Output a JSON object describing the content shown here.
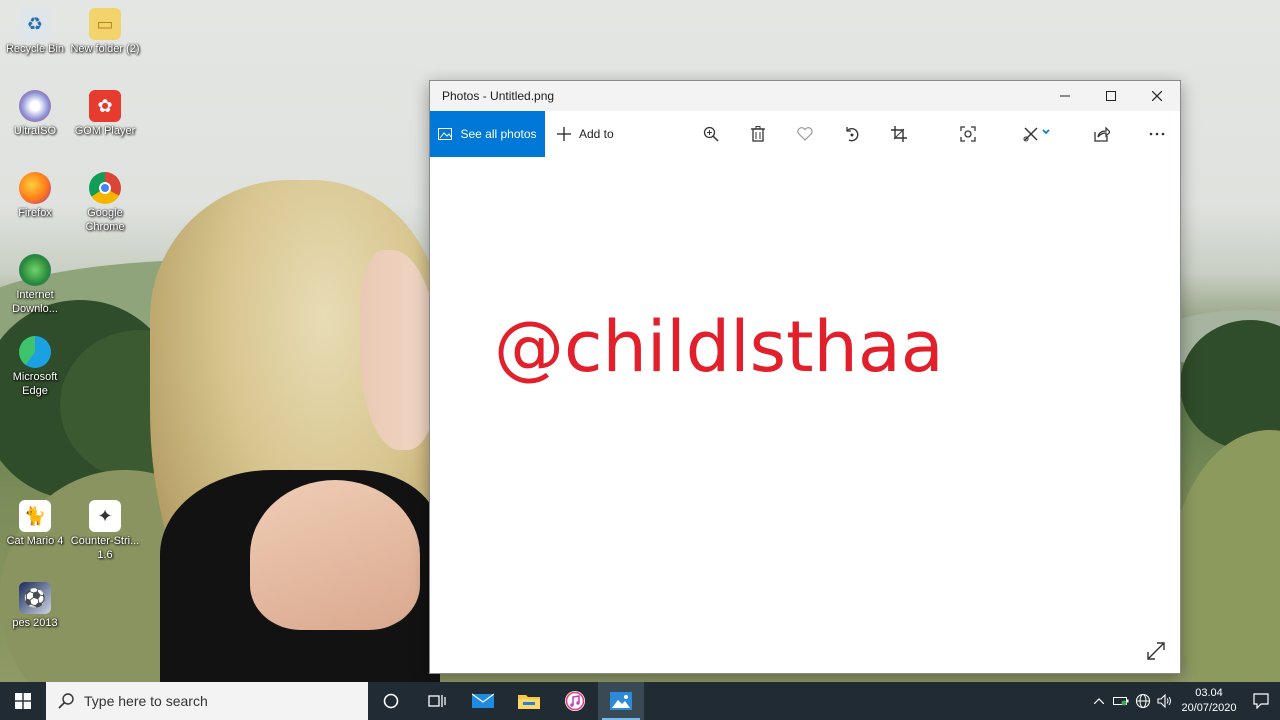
{
  "desktop": {
    "icons": [
      {
        "label": "Recycle Bin",
        "icon": "recycle-bin-icon"
      },
      {
        "label": "New folder (2)",
        "icon": "folder-icon"
      },
      {
        "label": "UltraISO",
        "icon": "ultraiso-icon"
      },
      {
        "label": "GOM Player",
        "icon": "gom-player-icon"
      },
      {
        "label": "Firefox",
        "icon": "firefox-icon"
      },
      {
        "label": "Google Chrome",
        "icon": "chrome-icon"
      },
      {
        "label": "Internet Downlo...",
        "icon": "idm-icon"
      },
      {
        "label": "Microsoft Edge",
        "icon": "edge-icon"
      },
      {
        "label": "Cat Mario 4",
        "icon": "cat-mario-icon"
      },
      {
        "label": "Counter-Stri... 1.6",
        "icon": "counter-strike-icon"
      },
      {
        "label": "pes 2013",
        "icon": "pes-icon"
      }
    ]
  },
  "window": {
    "title": "Photos - Untitled.png",
    "toolbar": {
      "see_all_label": "See all photos",
      "add_to_label": "Add to"
    },
    "image_text": "@childlsthaa",
    "accent_color": "#0078d7",
    "image_text_color": "#e2202c"
  },
  "taskbar": {
    "search_placeholder": "Type here to search",
    "clock_time": "03.04",
    "clock_date": "20/07/2020"
  }
}
